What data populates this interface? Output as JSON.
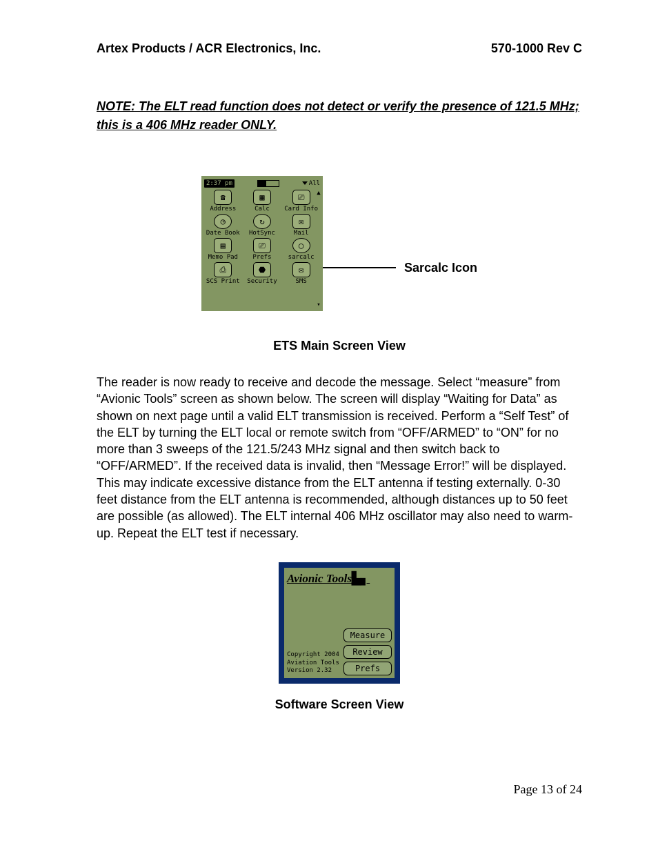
{
  "header": {
    "left": "Artex Products / ACR Electronics, Inc.",
    "right": "570-1000 Rev C"
  },
  "note": "NOTE: The ELT read function does not detect or verify the presence of 121.5 MHz; this is a 406 MHz reader ONLY.",
  "fig1": {
    "time": "2:37 pm",
    "category": "All",
    "apps": [
      {
        "label": "Address",
        "glyph": "☎"
      },
      {
        "label": "Calc",
        "glyph": "▦"
      },
      {
        "label": "Card Info",
        "glyph": "⎚"
      },
      {
        "label": "Date Book",
        "glyph": "◷"
      },
      {
        "label": "HotSync",
        "glyph": "↻"
      },
      {
        "label": "Mail",
        "glyph": "✉"
      },
      {
        "label": "Memo Pad",
        "glyph": "▤"
      },
      {
        "label": "Prefs",
        "glyph": "⎚"
      },
      {
        "label": "sarcalc",
        "glyph": "◯"
      },
      {
        "label": "SCS Print",
        "glyph": "⎙"
      },
      {
        "label": "Security",
        "glyph": "⬣"
      },
      {
        "label": "SMS",
        "glyph": "✉"
      }
    ],
    "callout": "Sarcalc Icon",
    "caption": "ETS Main Screen View"
  },
  "body": "The reader is now ready to receive and decode the message.  Select “measure” from “Avionic Tools” screen as shown below. The screen will display “Waiting for Data” as shown on next page until a valid ELT transmission is received.  Perform a “Self Test” of the ELT by turning the ELT local or remote switch from “OFF/ARMED” to “ON” for no more than 3 sweeps of the 121.5/243 MHz signal and then switch back to “OFF/ARMED”. If the received data is invalid, then “Message Error!” will be displayed.  This may indicate excessive distance from the ELT antenna if testing externally.  0-30 feet distance from the ELT antenna is recommended, although distances up to 50 feet are possible (as allowed). The ELT internal 406 MHz oscillator may also need to warm-up. Repeat the ELT test if necessary.",
  "fig2": {
    "title": "Avionic Tools",
    "copyright": [
      "Copyright 2004",
      "Aviation Tools",
      "Version 2.32"
    ],
    "buttons": [
      "Measure",
      "Review",
      "Prefs"
    ],
    "caption": "Software Screen View"
  },
  "footer": "Page 13 of 24"
}
